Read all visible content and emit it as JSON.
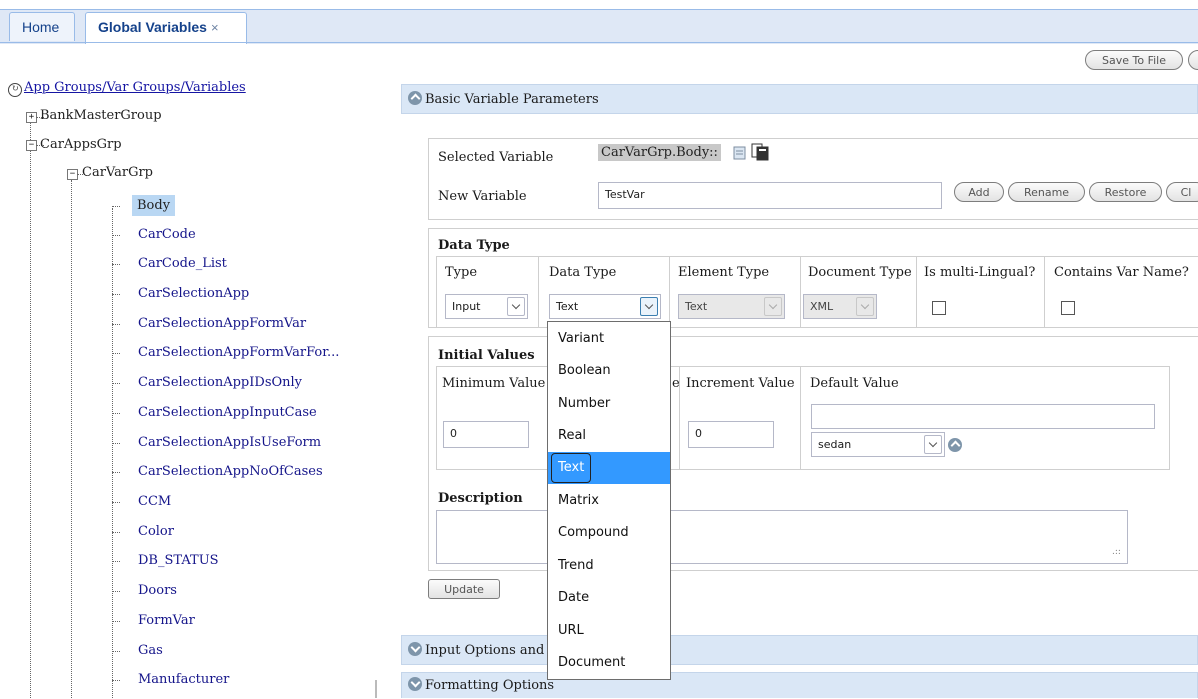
{
  "tabs": {
    "home": "Home",
    "global_variables": "Global Variables",
    "close": "×"
  },
  "toolbar": {
    "save_to_file": "Save To File"
  },
  "tree": {
    "root": "App Groups/Var Groups/Variables",
    "groups": [
      "BankMasterGroup",
      "CarAppsGrp"
    ],
    "var_group": "CarVarGrp",
    "variables": [
      "Body",
      "CarCode",
      "CarCode_List",
      "CarSelectionApp",
      "CarSelectionAppFormVar",
      "CarSelectionAppFormVarFor...",
      "CarSelectionAppIDsOnly",
      "CarSelectionAppInputCase",
      "CarSelectionAppIsUseForm",
      "CarSelectionAppNoOfCases",
      "CCM",
      "Color",
      "DB_STATUS",
      "Doors",
      "FormVar",
      "Gas",
      "Manufacturer"
    ]
  },
  "basic": {
    "title": "Basic Variable Parameters",
    "selected_variable_label": "Selected Variable",
    "selected_variable_value": "CarVarGrp.Body::",
    "new_variable_label": "New Variable",
    "new_variable_value": "TestVar",
    "buttons": [
      "Add",
      "Rename",
      "Restore",
      "Cl"
    ]
  },
  "data_type": {
    "section": "Data Type",
    "columns": [
      "Type",
      "Data Type",
      "Element Type",
      "Document Type",
      "Is multi-Lingual?",
      "Contains Var Name?"
    ],
    "type_value": "Input",
    "data_type_value": "Text",
    "element_type_value": "Text",
    "document_type_value": "XML"
  },
  "initial_values": {
    "section": "Initial Values",
    "minimum_label": "Minimum Value",
    "maximum_label_fragment": "e",
    "increment_label": "Increment Value",
    "default_label": "Default Value",
    "minimum_value": "0",
    "increment_value": "0",
    "default_select": "sedan"
  },
  "description": {
    "label": "Description"
  },
  "update_button": "Update",
  "panels": {
    "input_options": "Input Options and",
    "formatting": "Formatting Options"
  },
  "dropdown": {
    "options": [
      "Variant",
      "Boolean",
      "Number",
      "Real",
      "Text",
      "Matrix",
      "Compound",
      "Trend",
      "Date",
      "URL",
      "Document"
    ],
    "highlighted": "Text"
  },
  "colors": {
    "tab_strip": "#dfe8f6",
    "panel_header": "#dae7f6",
    "highlight": "#3399ff",
    "link": "#15158a"
  },
  "icons": [
    "refresh-icon",
    "expand-icon",
    "collapse-icon",
    "doc-icon",
    "copy-icon",
    "collapse-circle-icon",
    "expand-circle-icon"
  ]
}
